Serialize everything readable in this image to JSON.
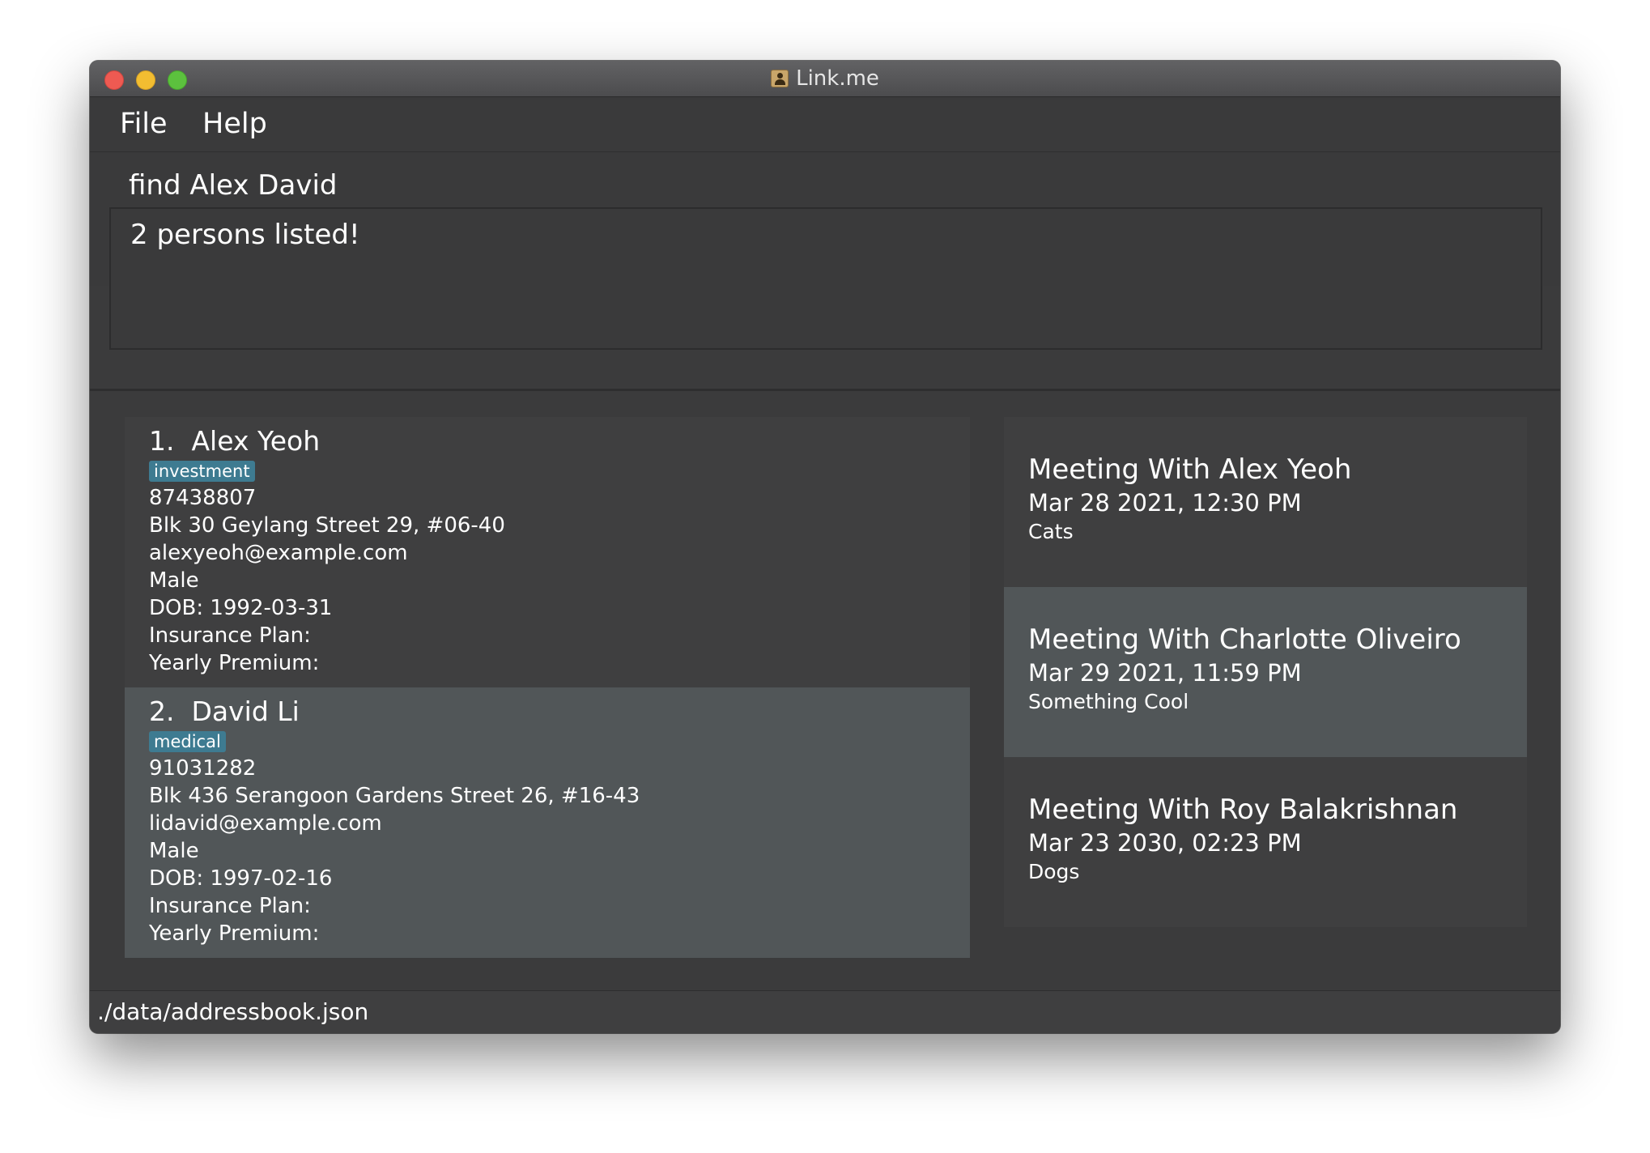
{
  "window": {
    "title": "Link.me",
    "icon": "contact-book-icon"
  },
  "menu": {
    "file_label": "File",
    "help_label": "Help"
  },
  "command": {
    "value": "find Alex David"
  },
  "result": {
    "message": "2 persons listed!"
  },
  "persons": [
    {
      "index": "1.",
      "name": "Alex Yeoh",
      "tag": "investment",
      "phone": "87438807",
      "address": "Blk 30 Geylang Street 29, #06-40",
      "email": "alexyeoh@example.com",
      "gender": "Male",
      "dob": "DOB: 1992-03-31",
      "insurance_plan": "Insurance Plan:",
      "yearly_premium": "Yearly Premium:"
    },
    {
      "index": "2.",
      "name": "David Li",
      "tag": "medical",
      "phone": "91031282",
      "address": "Blk 436 Serangoon Gardens Street 26, #16-43",
      "email": "lidavid@example.com",
      "gender": "Male",
      "dob": "DOB: 1997-02-16",
      "insurance_plan": "Insurance Plan:",
      "yearly_premium": "Yearly Premium:"
    }
  ],
  "meetings": [
    {
      "title": "Meeting With Alex Yeoh",
      "datetime": "Mar 28 2021, 12:30 PM",
      "note": "Cats"
    },
    {
      "title": "Meeting With Charlotte Oliveiro",
      "datetime": "Mar 29 2021, 11:59 PM",
      "note": "Something Cool"
    },
    {
      "title": "Meeting With Roy Balakrishnan",
      "datetime": "Mar 23 2030, 02:23 PM",
      "note": "Dogs"
    }
  ],
  "status": {
    "file_path": "./data/addressbook.json"
  },
  "colors": {
    "window_bg": "#3b3b3c",
    "card_dark": "#3f3f40",
    "card_light": "#515658",
    "tag_bg": "#3e7b91"
  }
}
